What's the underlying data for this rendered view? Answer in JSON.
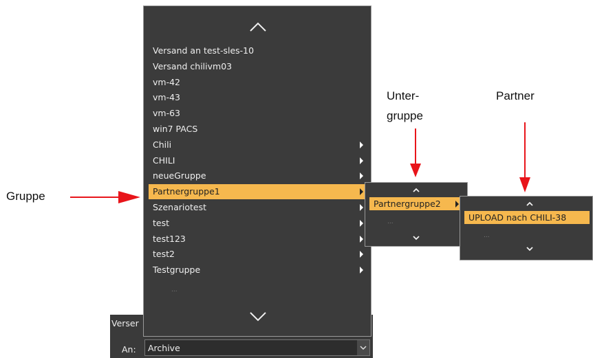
{
  "annotations": {
    "gruppe": "Gruppe",
    "untergruppe_line1": "Unter-",
    "untergruppe_line2": "gruppe",
    "partner": "Partner"
  },
  "group_menu": {
    "items": [
      {
        "label": "Versand an test-sles-10",
        "submenu": false
      },
      {
        "label": "Versand chilivm03",
        "submenu": false
      },
      {
        "label": "vm-42",
        "submenu": false
      },
      {
        "label": "vm-43",
        "submenu": false
      },
      {
        "label": "vm-63",
        "submenu": false
      },
      {
        "label": "win7 PACS",
        "submenu": false
      },
      {
        "label": "Chili",
        "submenu": true
      },
      {
        "label": "CHILI",
        "submenu": true
      },
      {
        "label": "neueGruppe",
        "submenu": true
      },
      {
        "label": "Partnergruppe1",
        "submenu": true,
        "selected": true
      },
      {
        "label": "Szenariotest",
        "submenu": true
      },
      {
        "label": "test",
        "submenu": true
      },
      {
        "label": "test123",
        "submenu": true
      },
      {
        "label": "test2",
        "submenu": true
      },
      {
        "label": "Testgruppe",
        "submenu": true
      }
    ],
    "more": "...",
    "scroll_up_icon": "chevron-up-icon",
    "scroll_down_icon": "chevron-down-icon"
  },
  "subgroup_menu": {
    "items": [
      {
        "label": "Partnergruppe2",
        "submenu": true,
        "selected": true
      }
    ],
    "more": "..."
  },
  "partner_menu": {
    "items": [
      {
        "label": "UPLOAD nach CHILI-38",
        "submenu": false,
        "selected": true
      }
    ],
    "more": "..."
  },
  "dialog": {
    "title_partial": "Verser",
    "to_label": "An:",
    "to_value": "Archive"
  },
  "colors": {
    "panel_bg": "#3b3b3b",
    "highlight": "#f6b84e",
    "arrow": "#e8141a"
  }
}
